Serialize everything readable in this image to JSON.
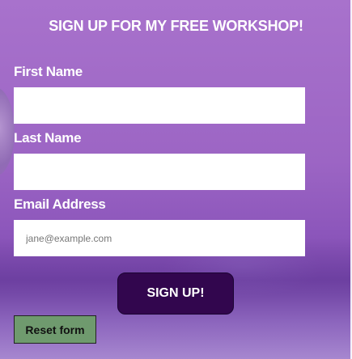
{
  "form": {
    "title": "SIGN UP FOR MY FREE WORKSHOP!",
    "first_name": {
      "label": "First Name",
      "value": "",
      "placeholder": ""
    },
    "last_name": {
      "label": "Last Name",
      "value": "",
      "placeholder": ""
    },
    "email": {
      "label": "Email Address",
      "value": "",
      "placeholder": "jane@example.com"
    },
    "submit_label": "SIGN UP!",
    "reset_label": "Reset form"
  },
  "colors": {
    "background": "#9c65c4",
    "submit_button": "#32064e",
    "reset_button": "#6f9a6e",
    "text": "#ffffff"
  }
}
